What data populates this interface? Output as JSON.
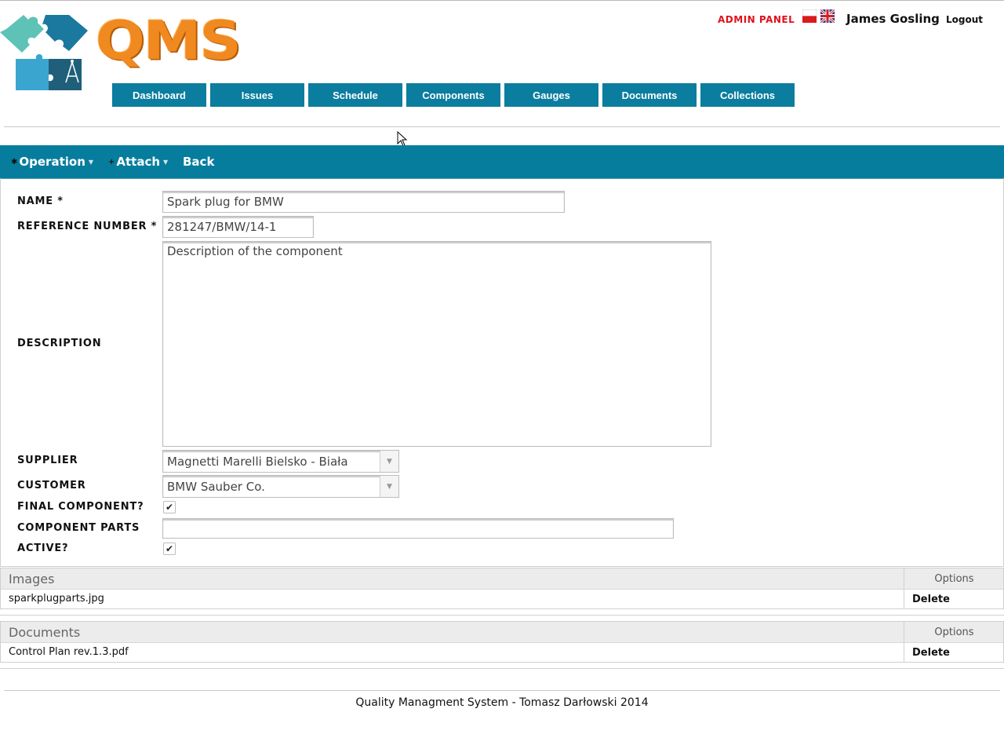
{
  "brand": {
    "logo_text": "QMS",
    "accent": "#f0891f",
    "primary": "#0b7d9e"
  },
  "header": {
    "admin_panel": "ADMIN PANEL",
    "user_name": "James Gosling",
    "logout": "Logout",
    "languages": [
      "polish-flag-icon",
      "uk-flag-icon"
    ]
  },
  "nav": {
    "items": [
      "Dashboard",
      "Issues",
      "Schedule",
      "Components",
      "Gauges",
      "Documents",
      "Collections"
    ]
  },
  "toolbar": {
    "operation": "Operation",
    "attach": "Attach",
    "back": "Back"
  },
  "form": {
    "name_label": "NAME *",
    "name_value": "Spark plug for BMW",
    "ref_label": "REFERENCE NUMBER *",
    "ref_value": "281247/BMW/14-1",
    "desc_label": "DESCRIPTION",
    "desc_value": "Description of the component",
    "supplier_label": "SUPPLIER",
    "supplier_value": "Magnetti Marelli Bielsko - Biała",
    "customer_label": "CUSTOMER",
    "customer_value": "BMW Sauber Co.",
    "final_label": "FINAL COMPONENT?",
    "final_checked": true,
    "parts_label": "COMPONENT PARTS",
    "parts_value": "",
    "active_label": "ACTIVE?",
    "active_checked": true
  },
  "images": {
    "title": "Images",
    "options_header": "Options",
    "rows": [
      {
        "name": "sparkplugparts.jpg",
        "action": "Delete"
      }
    ]
  },
  "documents": {
    "title": "Documents",
    "options_header": "Options",
    "rows": [
      {
        "name": "Control Plan rev.1.3.pdf",
        "action": "Delete"
      }
    ]
  },
  "footer": {
    "text": "Quality Managment System - Tomasz Darłowski 2014"
  }
}
